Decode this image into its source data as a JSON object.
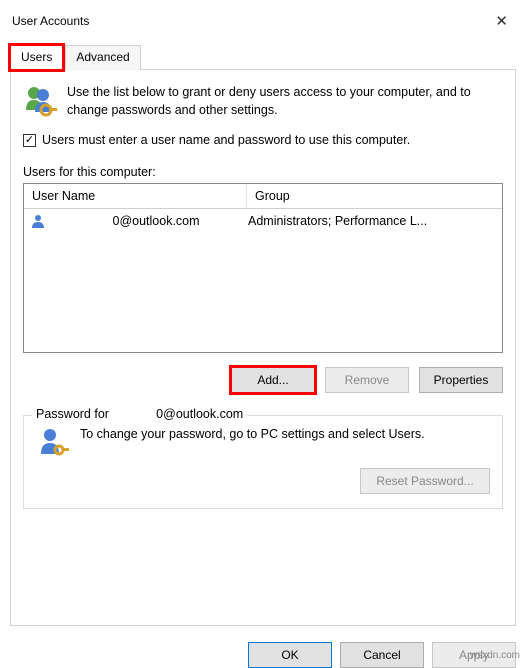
{
  "window": {
    "title": "User Accounts"
  },
  "tabs": {
    "users": "Users",
    "advanced": "Advanced"
  },
  "intro": {
    "text": "Use the list below to grant or deny users access to your computer, and to change passwords and other settings."
  },
  "checkbox": {
    "checked": true,
    "label": "Users must enter a user name and password to use this computer."
  },
  "listbox": {
    "label": "Users for this computer:",
    "columns": {
      "user": "User Name",
      "group": "Group"
    },
    "rows": [
      {
        "user": "0@outlook.com",
        "group": "Administrators; Performance L..."
      }
    ]
  },
  "buttons": {
    "add": "Add...",
    "remove": "Remove",
    "properties": "Properties",
    "reset_password": "Reset Password...",
    "ok": "OK",
    "cancel": "Cancel",
    "apply": "Apply"
  },
  "password_group": {
    "legend_prefix": "Password for ",
    "legend_user": "0@outlook.com",
    "text": "To change your password, go to PC settings and select Users."
  },
  "watermark": "wsxdn.com"
}
